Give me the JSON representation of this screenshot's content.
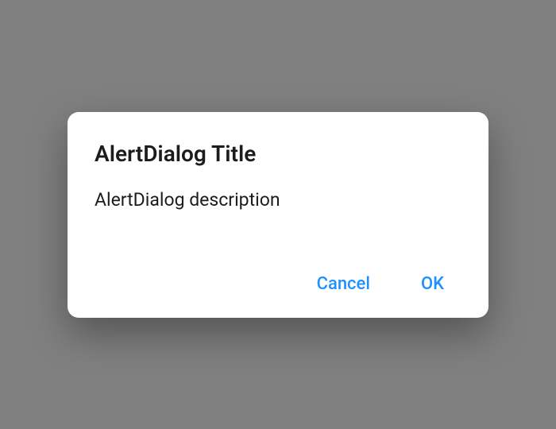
{
  "dialog": {
    "title": "AlertDialog Title",
    "description": "AlertDialog description",
    "actions": {
      "cancel": "Cancel",
      "ok": "OK"
    }
  },
  "colors": {
    "background": "#808080",
    "dialog_bg": "#ffffff",
    "text": "#1c1c1e",
    "accent": "#1e90ff"
  }
}
